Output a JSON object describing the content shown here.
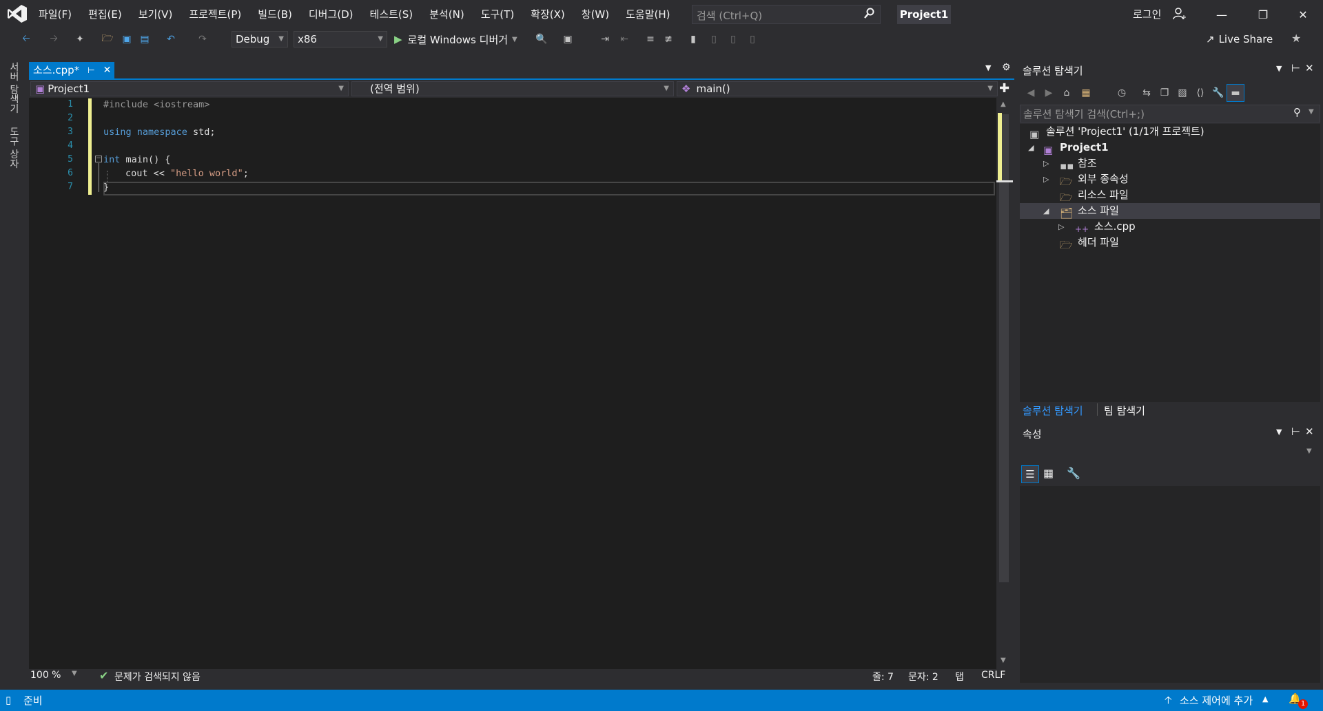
{
  "menu": [
    "파일(F)",
    "편집(E)",
    "보기(V)",
    "프로젝트(P)",
    "빌드(B)",
    "디버그(D)",
    "테스트(S)",
    "분석(N)",
    "도구(T)",
    "확장(X)",
    "창(W)",
    "도움말(H)"
  ],
  "search": {
    "placeholder": "검색 (Ctrl+Q)"
  },
  "project_title": "Project1",
  "login": "로그인",
  "toolbar": {
    "config": "Debug",
    "platform": "x86",
    "run_label": "로컬 Windows 디버거",
    "live_share": "Live Share"
  },
  "side_tabs": [
    "서버 탐색기",
    "도구 상자"
  ],
  "editor": {
    "tab_label": "소스.cpp*",
    "nav_project": "Project1",
    "nav_scope": "(전역 범위)",
    "nav_member": "main()",
    "line_numbers": [
      "1",
      "2",
      "3",
      "4",
      "5",
      "6",
      "7"
    ],
    "code": {
      "l1_pp": "#include",
      "l1_rest": " <iostream>",
      "l3_kw": "using namespace",
      "l3_rest": " std;",
      "l5_kw": "int",
      "l5_rest": " main() {",
      "l6_a": "cout << ",
      "l6_str": "\"hello world\"",
      "l6_b": ";",
      "l7": "}"
    },
    "zoom": "100 %",
    "issues": "문제가 검색되지 않음",
    "line_info": "줄: 7",
    "char_info": "문자: 2",
    "tab_mode": "탭",
    "eol": "CRLF"
  },
  "solution_explorer": {
    "title": "솔루션 탐색기",
    "search_placeholder": "솔루션 탐색기 검색(Ctrl+;)",
    "solution_label": "솔루션 'Project1' (1/1개 프로젝트)",
    "project_label": "Project1",
    "references": "참조",
    "external_deps": "외부 종속성",
    "resource_files": "리소스 파일",
    "source_files": "소스 파일",
    "source_cpp": "소스.cpp",
    "header_files": "헤더 파일",
    "tab_solution": "솔루션 탐색기",
    "tab_team": "팀 탐색기"
  },
  "properties": {
    "title": "속성"
  },
  "status": {
    "ready": "준비",
    "source_control": "소스 제어에 추가",
    "notifications": "1"
  },
  "colors": {
    "accent": "#007acc",
    "editor_bg": "#1e1e1e",
    "chrome_bg": "#2d2d30",
    "change_marker": "#efef91"
  }
}
